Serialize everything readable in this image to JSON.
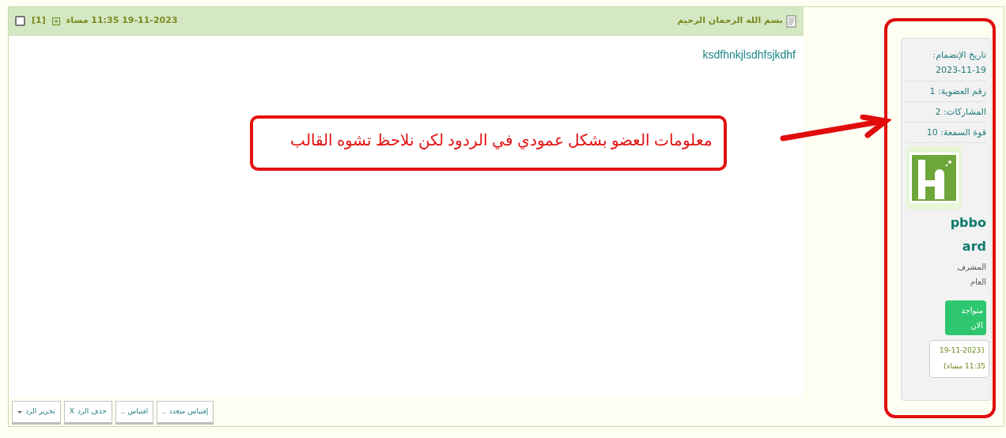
{
  "post": {
    "title": "بسم الله الرحمان الرحيم",
    "datetime": "19-11-2023 11:35 مساء",
    "number": "[1]",
    "selected": false,
    "body": "ksdfhnkjlsdhfsjkdhf",
    "buttons": [
      {
        "kind": "plain",
        "label": "إقتباس متعدد .."
      },
      {
        "kind": "plain",
        "label": "اقتباس .."
      },
      {
        "kind": "delete",
        "icon": "X",
        "label": "حذف الرد"
      },
      {
        "kind": "dropdown",
        "label": "تحرير الرد"
      }
    ]
  },
  "member": {
    "stats": [
      {
        "kind": "stacked",
        "label": "تاريخ الإنضمام:",
        "value": "2023-11-19"
      },
      {
        "kind": "inline",
        "label": "رقم العضوية:",
        "value": "1"
      },
      {
        "kind": "inline",
        "label": "المشاركات:",
        "value": "2"
      },
      {
        "kind": "inline",
        "label": "قوة السمعة:",
        "value": "10"
      }
    ],
    "username": "pbboard",
    "role": "المشرف العام",
    "online_label": "متواجد الان",
    "last_visit": "{19-11-2023 11:35 مساء}"
  },
  "annotation": {
    "text": "معلومات العضو بشكل عمودي في الردود لكن نلاحظ تشوه القالب"
  }
}
